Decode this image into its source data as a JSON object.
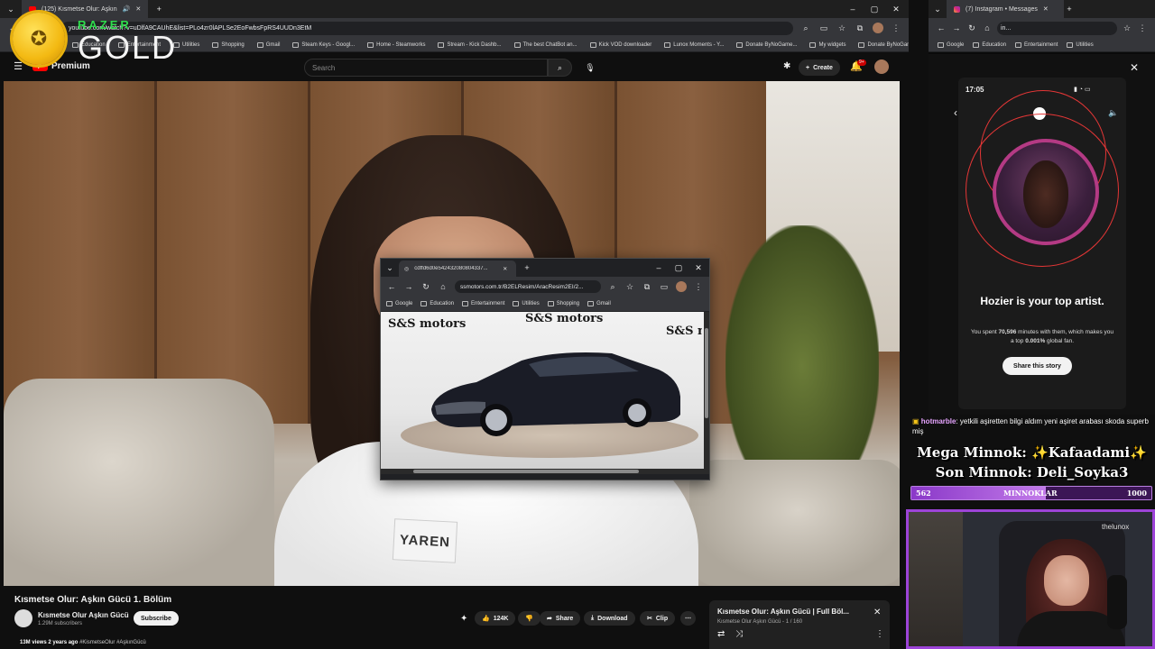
{
  "youtube": {
    "tab_title": "(125) Kısmetse Olur: Aşkın",
    "url": "youtube.com/watch?v=uDlfA9CAUhE&list=PLo4zr0lAPLSe2EoFwbsFpRS4UUDn3EtM",
    "bookmarks": [
      "Education",
      "Entertainment",
      "Utilities",
      "Shopping",
      "Gmail",
      "Steam Keys - Googl...",
      "Home - Steamworks",
      "Stream - Kick Dashb...",
      "The best ChatBot an...",
      "Kick VOD downloader",
      "Lunox Moments - Y...",
      "Donate ByNoGame...",
      "My widgets",
      "Donate ByNoGame"
    ],
    "logo_label": "Premium",
    "search_placeholder": "Search",
    "create_label": "Create",
    "notif_count": "9+",
    "nametag": "YAREN",
    "video_title": "Kısmetse Olur: Aşkın Gücü 1. Bölüm",
    "channel_name": "Kısmetse Olur Aşkın Gücü",
    "channel_subs": "1.29M subscribers",
    "subscribe_label": "Subscribe",
    "likes": "124K",
    "share_label": "Share",
    "download_label": "Download",
    "clip_label": "Clip",
    "views": "13M views",
    "age": "2 years ago",
    "hashtags": "#KismetseOlur #AşkınGücü",
    "playlist_title": "Kısmetse Olur: Aşkın Gücü | Full Böl...",
    "playlist_sub": "Kısmetse Olur Aşkın Gücü - 1 / 160"
  },
  "overlay": {
    "razer_label": "RAZER",
    "gold_label": "GOLD"
  },
  "popup": {
    "tab_title": "cdffd6d0e542432080804337...",
    "url": "ssmotors.com.tr/B2ELResim/AracResim2EI/2...",
    "bookmarks": [
      "Google",
      "Education",
      "Entertainment",
      "Utilities",
      "Shopping",
      "Gmail"
    ],
    "brand": "S&S motors"
  },
  "instagram": {
    "tab_title": "(7) Instagram • Messages",
    "url": "in...",
    "bookmarks": [
      "Google",
      "Education",
      "Entertainment",
      "Utilities"
    ],
    "status_time": "17:05",
    "story_title": "Hozier is your top artist.",
    "story_text_a": "You spent ",
    "story_minutes": "70,596",
    "story_text_b": " minutes with them, which makes you a top ",
    "story_percent": "0.001%",
    "story_text_c": " global fan.",
    "share_label": "Share this story"
  },
  "stream": {
    "chat_user": "hotmarble",
    "chat_message": ": yetkili aşiretten bilgi aldım yeni aşiret arabası skoda superb miş",
    "minnok_line1": "Mega Minnok: ✨Kafaadami✨",
    "minnok_line2": "Son Minnok: Deli_Soyka3",
    "progress_current": "562",
    "progress_label": "MINNOKLAR",
    "progress_goal": "1000",
    "progress_fraction": 0.562,
    "cam_watermark": "thelunox"
  },
  "colors": {
    "yt_red": "#ff0000",
    "stream_purple": "#9d44d8",
    "razer_green": "#2fdc4d"
  }
}
